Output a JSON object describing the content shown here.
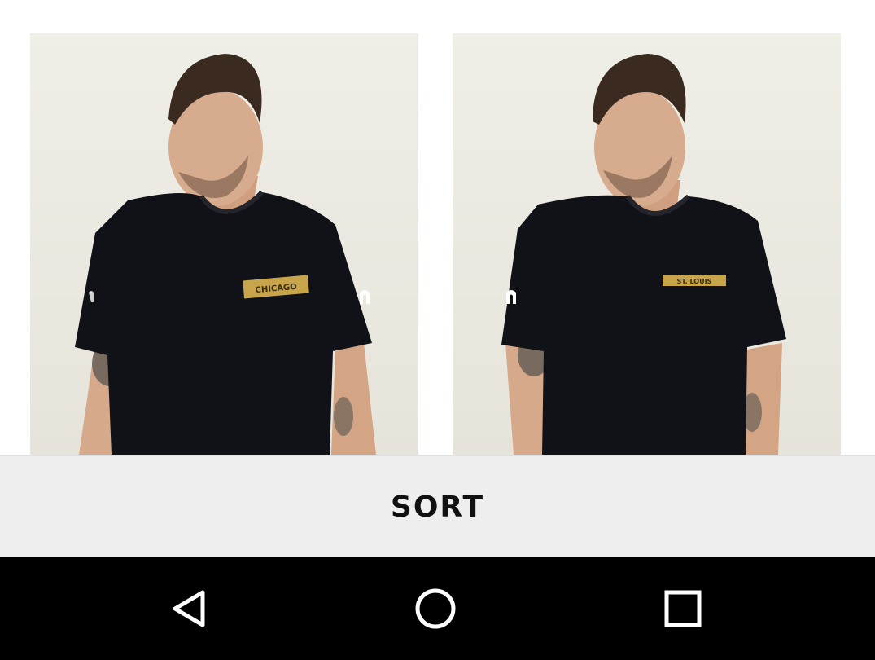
{
  "products": [
    {
      "chest_print": "CHICAGO",
      "sleeve_logo": "horseshoe-logo"
    },
    {
      "chest_print": "ST. LOUIS",
      "sleeve_logo": "horseshoe-logo"
    }
  ],
  "sort": {
    "label": "SORT"
  },
  "nav": {
    "icons": [
      "back-icon",
      "home-icon",
      "recent-apps-icon"
    ]
  },
  "colors": {
    "sort_bar": "#eeeeee",
    "nav_bar": "#000000",
    "shirt": "#111118",
    "patch": "#c8a54a"
  }
}
